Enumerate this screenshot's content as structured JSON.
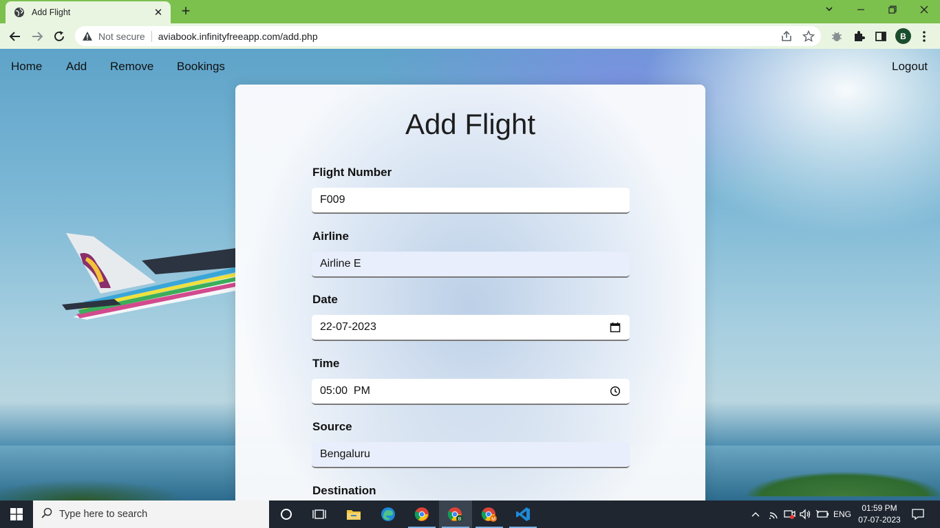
{
  "browser": {
    "tab_title": "Add Flight",
    "new_tab_symbol": "+",
    "close_symbol": "✕",
    "security_text": "Not secure",
    "url": "aviabook.infinityfreeapp.com/add.php",
    "profile_initial": "B"
  },
  "nav": {
    "home": "Home",
    "add": "Add",
    "remove": "Remove",
    "bookings": "Bookings",
    "logout": "Logout"
  },
  "form": {
    "title": "Add Flight",
    "flight_number": {
      "label": "Flight Number",
      "value": "F009"
    },
    "airline": {
      "label": "Airline",
      "value": "Airline E"
    },
    "date": {
      "label": "Date",
      "value": "22-07-2023"
    },
    "time": {
      "label": "Time",
      "value": "05:00  PM"
    },
    "source": {
      "label": "Source",
      "value": "Bengaluru"
    },
    "destination": {
      "label": "Destination"
    }
  },
  "taskbar": {
    "search_placeholder": "Type here to search",
    "language": "ENG",
    "time": "01:59 PM",
    "date": "07-07-2023"
  },
  "colors": {
    "chrome_frame": "#7cc04e",
    "chrome_toolbar": "#eaf5e1",
    "taskbar": "#1f2630",
    "autofill_field": "#e8eefb"
  }
}
